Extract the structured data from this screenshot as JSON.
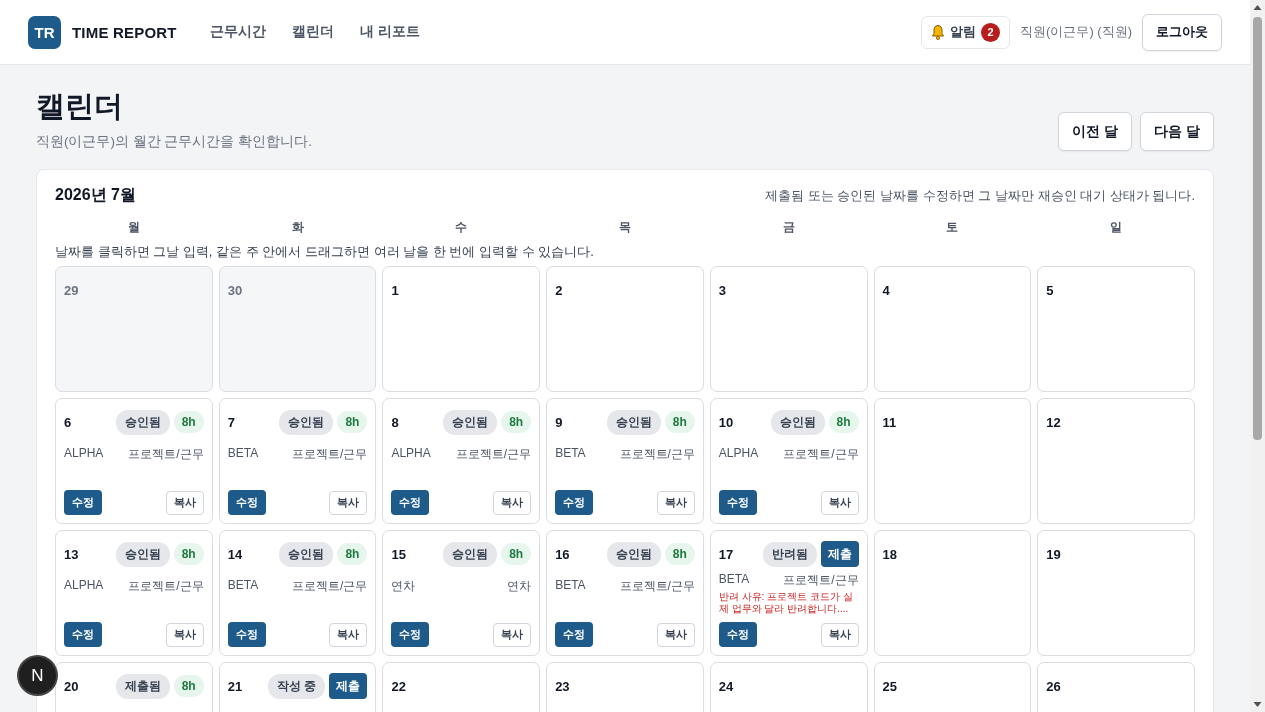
{
  "app": {
    "logo": "TR",
    "name": "TIME REPORT"
  },
  "nav": [
    {
      "label": "근무시간",
      "selected": false
    },
    {
      "label": "캘린더",
      "selected": false
    },
    {
      "label": "내 리포트",
      "selected": false
    }
  ],
  "alerts": {
    "label": "알림",
    "count": "2"
  },
  "user": "직원(이근무) (직원)",
  "logout": "로그아웃",
  "page": {
    "title": "캘린더",
    "subtitle": "직원(이근무)의 월간 근무시간을 확인합니다.",
    "prev": "이전 달",
    "next": "다음 달"
  },
  "calendar": {
    "month": "2026년 7월",
    "notice": "제출됨 또는 승인된 날짜를 수정하면 그 날짜만 재승인 대기 상태가 됩니다.",
    "weekdays": [
      "월",
      "화",
      "수",
      "목",
      "금",
      "토",
      "일"
    ],
    "hint": "날짜를 클릭하면 그날 입력, 같은 주 안에서 드래그하면 여러 날을 한 번에 입력할 수 있습니다.",
    "weeks": [
      [
        {
          "day": "29",
          "outside": true
        },
        {
          "day": "30",
          "outside": true
        },
        {
          "day": "1",
          "outside": false
        },
        {
          "day": "2",
          "outside": false
        },
        {
          "day": "3",
          "outside": false
        },
        {
          "day": "4",
          "outside": false
        },
        {
          "day": "5",
          "outside": false
        }
      ],
      [
        {
          "day": "6",
          "outside": false,
          "status": "승인됨",
          "hours": "8h",
          "project": "ALPHA",
          "category": "프로젝트/근무",
          "edit": "수정",
          "copy": "복사"
        },
        {
          "day": "7",
          "outside": false,
          "status": "승인됨",
          "hours": "8h",
          "project": "BETA",
          "category": "프로젝트/근무",
          "edit": "수정",
          "copy": "복사"
        },
        {
          "day": "8",
          "outside": false,
          "status": "승인됨",
          "hours": "8h",
          "project": "ALPHA",
          "category": "프로젝트/근무",
          "edit": "수정",
          "copy": "복사"
        },
        {
          "day": "9",
          "outside": false,
          "status": "승인됨",
          "hours": "8h",
          "project": "BETA",
          "category": "프로젝트/근무",
          "edit": "수정",
          "copy": "복사"
        },
        {
          "day": "10",
          "outside": false,
          "status": "승인됨",
          "hours": "8h",
          "project": "ALPHA",
          "category": "프로젝트/근무",
          "edit": "수정",
          "copy": "복사"
        },
        {
          "day": "11",
          "outside": false
        },
        {
          "day": "12",
          "outside": false
        }
      ],
      [
        {
          "day": "13",
          "outside": false,
          "status": "승인됨",
          "hours": "8h",
          "project": "ALPHA",
          "category": "프로젝트/근무",
          "edit": "수정",
          "copy": "복사"
        },
        {
          "day": "14",
          "outside": false,
          "status": "승인됨",
          "hours": "8h",
          "project": "BETA",
          "category": "프로젝트/근무",
          "edit": "수정",
          "copy": "복사"
        },
        {
          "day": "15",
          "outside": false,
          "status": "승인됨",
          "hours": "8h",
          "project": "연차",
          "category": "연차",
          "edit": "수정",
          "copy": "복사"
        },
        {
          "day": "16",
          "outside": false,
          "status": "승인됨",
          "hours": "8h",
          "project": "BETA",
          "category": "프로젝트/근무",
          "edit": "수정",
          "copy": "복사"
        },
        {
          "day": "17",
          "outside": false,
          "status": "반려됨",
          "submit": "제출",
          "project": "BETA",
          "category": "프로젝트/근무",
          "reason": "반려 사유: 프로젝트 코드가 실제 업무와 달라 반려합니다....",
          "edit": "수정",
          "copy": "복사"
        },
        {
          "day": "18",
          "outside": false
        },
        {
          "day": "19",
          "outside": false
        }
      ],
      [
        {
          "day": "20",
          "outside": false,
          "status": "제출됨",
          "hours": "8h"
        },
        {
          "day": "21",
          "outside": false,
          "status": "작성 중",
          "submit": "제출"
        },
        {
          "day": "22",
          "outside": false
        },
        {
          "day": "23",
          "outside": false
        },
        {
          "day": "24",
          "outside": false
        },
        {
          "day": "25",
          "outside": false
        },
        {
          "day": "26",
          "outside": false
        }
      ]
    ]
  },
  "dev_badge": "N"
}
